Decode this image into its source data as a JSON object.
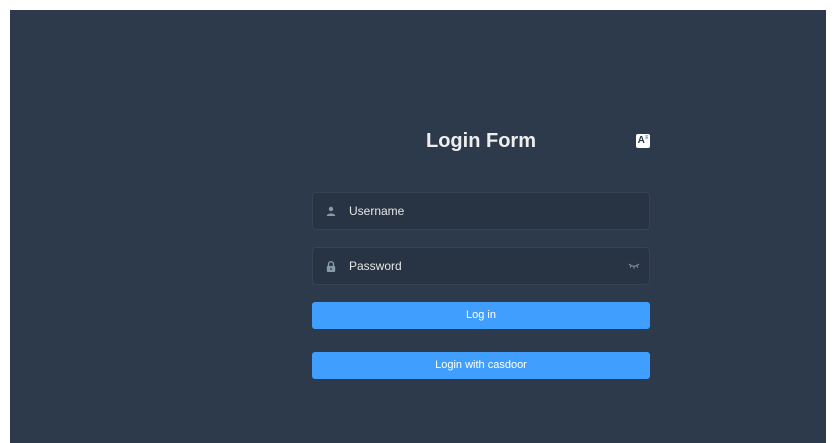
{
  "login_form": {
    "title": "Login Form",
    "language_switch_icon": "translate-icon",
    "username": {
      "placeholder": "Username",
      "value": "",
      "icon": "user-icon"
    },
    "password": {
      "placeholder": "Password",
      "value": "",
      "icon": "lock-icon",
      "toggle_icon": "eye-closed-icon"
    },
    "login_button": "Log in",
    "casdoor_button": "Login with casdoor"
  },
  "colors": {
    "background": "#2d3a4b",
    "input_background": "#283443",
    "button": "#409eff",
    "text": "#eeeeee"
  }
}
